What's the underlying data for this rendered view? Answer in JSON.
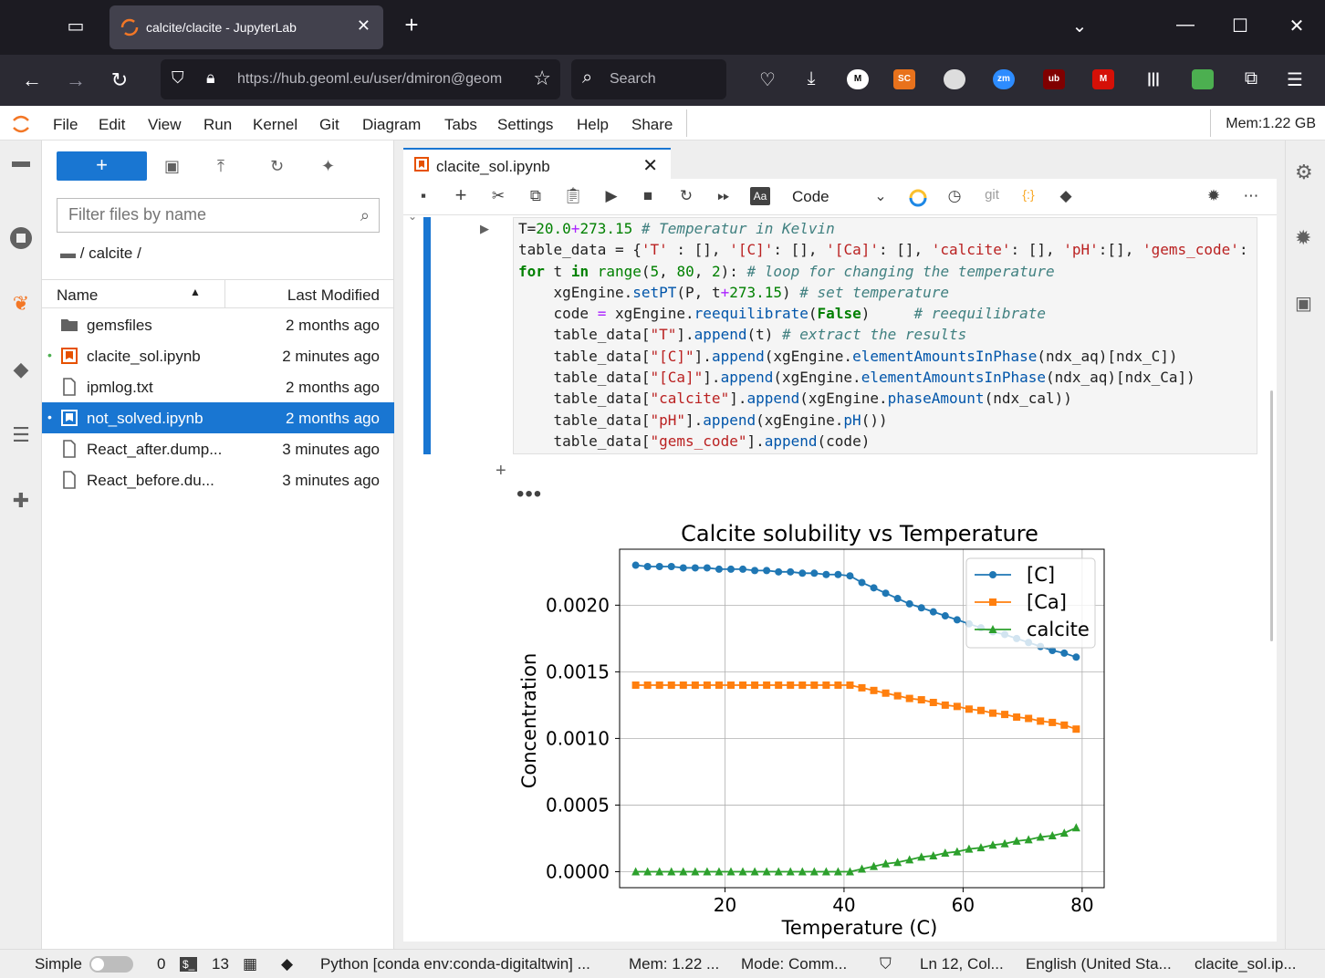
{
  "browser": {
    "tab_title": "calcite/clacite - JupyterLab",
    "url": "https://hub.geoml.eu/user/dmiron@geom",
    "search_placeholder": "Search"
  },
  "menu": [
    "File",
    "Edit",
    "View",
    "Run",
    "Kernel",
    "Git",
    "Diagram",
    "Tabs",
    "Settings",
    "Help",
    "Share"
  ],
  "mem_label": "Mem:1.22 GB",
  "filebrowser": {
    "filter_placeholder": "Filter files by name",
    "breadcrumb": "/ calcite /",
    "col_name": "Name",
    "col_modified": "Last Modified",
    "files": [
      {
        "name": "gemsfiles",
        "modified": "2 months ago",
        "type": "folder"
      },
      {
        "name": "clacite_sol.ipynb",
        "modified": "2 minutes ago",
        "type": "notebook",
        "running": true
      },
      {
        "name": "ipmlog.txt",
        "modified": "2 months ago",
        "type": "file"
      },
      {
        "name": "not_solved.ipynb",
        "modified": "2 months ago",
        "type": "notebook",
        "running": true,
        "selected": true
      },
      {
        "name": "React_after.dump...",
        "modified": "3 minutes ago",
        "type": "file"
      },
      {
        "name": "React_before.du...",
        "modified": "3 minutes ago",
        "type": "file"
      }
    ]
  },
  "notebook": {
    "tab_title": "clacite_sol.ipynb",
    "cell_type": "Code",
    "git_label": "git"
  },
  "chart_data": {
    "type": "line",
    "title": "Calcite solubility vs Temperature",
    "xlabel": "Temperature (C)",
    "ylabel": "Concentration",
    "xlim": [
      2.3,
      83.7
    ],
    "ylim": [
      -0.00012,
      0.00242
    ],
    "xticks": [
      "20",
      "40",
      "60",
      "80"
    ],
    "yticks": [
      "0.0000",
      "0.0005",
      "0.0010",
      "0.0015",
      "0.0020"
    ],
    "x": [
      5,
      7,
      9,
      11,
      13,
      15,
      17,
      19,
      21,
      23,
      25,
      27,
      29,
      31,
      33,
      35,
      37,
      39,
      41,
      43,
      45,
      47,
      49,
      51,
      53,
      55,
      57,
      59,
      61,
      63,
      65,
      67,
      69,
      71,
      73,
      75,
      77,
      79
    ],
    "series": [
      {
        "name": "[C]",
        "color": "#1f77b4",
        "marker": "circle",
        "values": [
          0.0023,
          0.00229,
          0.00229,
          0.00229,
          0.00228,
          0.00228,
          0.00228,
          0.00227,
          0.00227,
          0.00227,
          0.00226,
          0.00226,
          0.00225,
          0.00225,
          0.00224,
          0.00224,
          0.00223,
          0.00223,
          0.00222,
          0.00217,
          0.00213,
          0.00209,
          0.00205,
          0.00201,
          0.00198,
          0.00195,
          0.00192,
          0.00189,
          0.00186,
          0.00183,
          0.0018,
          0.00178,
          0.00175,
          0.00172,
          0.00169,
          0.00166,
          0.00164,
          0.00161
        ]
      },
      {
        "name": "[Ca]",
        "color": "#ff7f0e",
        "marker": "square",
        "values": [
          0.0014,
          0.0014,
          0.0014,
          0.0014,
          0.0014,
          0.0014,
          0.0014,
          0.0014,
          0.0014,
          0.0014,
          0.0014,
          0.0014,
          0.0014,
          0.0014,
          0.0014,
          0.0014,
          0.0014,
          0.0014,
          0.0014,
          0.00138,
          0.00136,
          0.00134,
          0.00132,
          0.0013,
          0.00129,
          0.00127,
          0.00125,
          0.00124,
          0.00122,
          0.00121,
          0.00119,
          0.00118,
          0.00116,
          0.00115,
          0.00113,
          0.00112,
          0.0011,
          0.00107
        ]
      },
      {
        "name": "calcite",
        "color": "#2ca02c",
        "marker": "triangle",
        "values": [
          0,
          0,
          0,
          0,
          0,
          0,
          0,
          0,
          0,
          0,
          0,
          0,
          0,
          0,
          0,
          0,
          0,
          0,
          0,
          2e-05,
          4e-05,
          6e-05,
          7e-05,
          9e-05,
          0.00011,
          0.00012,
          0.00014,
          0.00015,
          0.00017,
          0.00018,
          0.0002,
          0.00021,
          0.00023,
          0.00024,
          0.00026,
          0.00027,
          0.00029,
          0.00033
        ]
      }
    ],
    "legend": "top-right",
    "grid": true
  },
  "status": {
    "mode_simple": "Simple",
    "count_a": "0",
    "count_b": "13",
    "kernel": "Python [conda env:conda-digitaltwin] ...",
    "mem": "Mem: 1.22 ...",
    "mode": "Mode: Comm...",
    "position": "Ln 12, Col...",
    "lang": "English (United Sta...",
    "file": "clacite_sol.ip..."
  }
}
